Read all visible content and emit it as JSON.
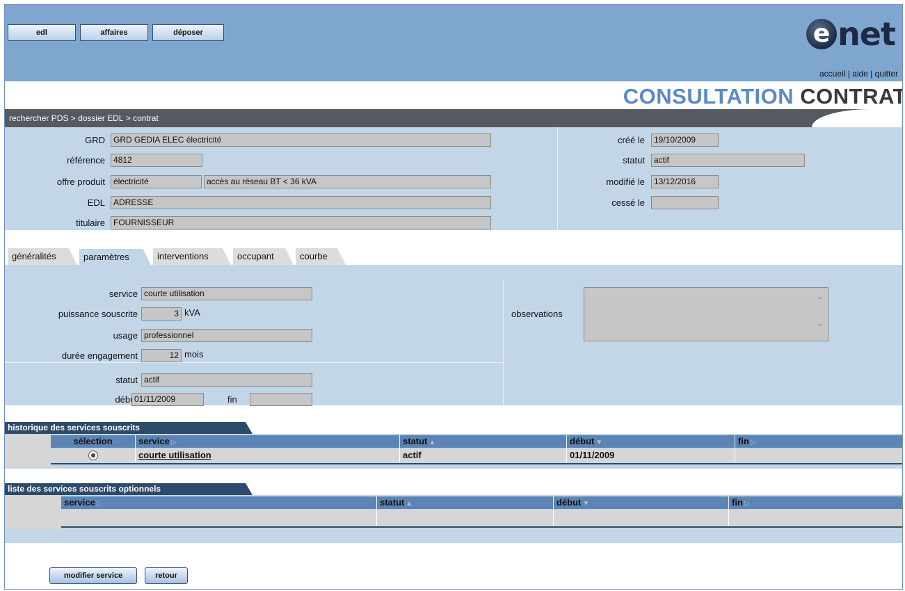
{
  "nav": {
    "edl": "edl",
    "affaires": "affaires",
    "deposer": "déposer"
  },
  "logo": {
    "e": "e",
    "net": "net"
  },
  "toplinks": {
    "accueil": "accueil",
    "aide": "aide",
    "quitter": "quitter",
    "sep": " | "
  },
  "title": {
    "part1": "CONSULTATION",
    "part2": "CONTRAT"
  },
  "breadcrumb": [
    {
      "label": "rechercher PDS"
    },
    {
      "label": "dossier EDL"
    },
    {
      "label": "contrat"
    }
  ],
  "breadcrumb_sep": " > ",
  "info": {
    "grd_label": "GRD",
    "grd_value": "GRD GEDIA ELEC électricité",
    "reference_label": "référence",
    "reference_value": "4812",
    "offre_label": "offre produit",
    "offre_value1": "électricité",
    "offre_value2": "accès au réseau BT < 36 kVA",
    "edl_label": "EDL",
    "edl_value": "ADRESSE",
    "titulaire_label": "titulaire",
    "titulaire_value": "FOURNISSEUR",
    "cree_label": "créé le",
    "cree_value": "19/10/2009",
    "statut_label": "statut",
    "statut_value": "actif",
    "modifie_label": "modifié le",
    "modifie_value": "13/12/2016",
    "cesse_label": "cessé le",
    "cesse_value": ""
  },
  "tabs": [
    {
      "label": "généralités",
      "active": false
    },
    {
      "label": "paramètres",
      "active": true
    },
    {
      "label": "interventions",
      "active": false
    },
    {
      "label": "occupant",
      "active": false
    },
    {
      "label": "courbe",
      "active": false
    }
  ],
  "params": {
    "service_label": "service",
    "service_value": "courte utilisation",
    "puissance_label": "puissance souscrite",
    "puissance_value": "3",
    "puissance_unit": "kVA",
    "usage_label": "usage",
    "usage_value": "professionnel",
    "duree_label": "durée engagement",
    "duree_value": "12",
    "duree_unit": "mois",
    "statut_label": "statut",
    "statut_value": "actif",
    "debut_label": "début",
    "debut_value": "01/11/2009",
    "fin_label": "fin",
    "fin_value": "",
    "observations_label": "observations",
    "observations_value": ""
  },
  "historique": {
    "title": "historique des services souscrits",
    "headers": {
      "selection": "sélection",
      "service": "service",
      "statut": "statut",
      "debut": "début",
      "fin": "fin"
    },
    "rows": [
      {
        "service": "courte utilisation",
        "statut": "actif",
        "debut": "01/11/2009",
        "fin": ""
      }
    ]
  },
  "optionnels": {
    "title": "liste des services souscrits optionnels",
    "headers": {
      "service": "service",
      "statut": "statut",
      "debut": "début",
      "fin": "fin"
    }
  },
  "buttons": {
    "modifier": "modifier service",
    "retour": "retour"
  },
  "colors": {
    "topbar": "#7fa6cf",
    "panel": "#c3d6e8",
    "header_dark": "#2e4a6a",
    "title_blue": "#5b8ac5",
    "title_dark": "#3a3a3a"
  }
}
